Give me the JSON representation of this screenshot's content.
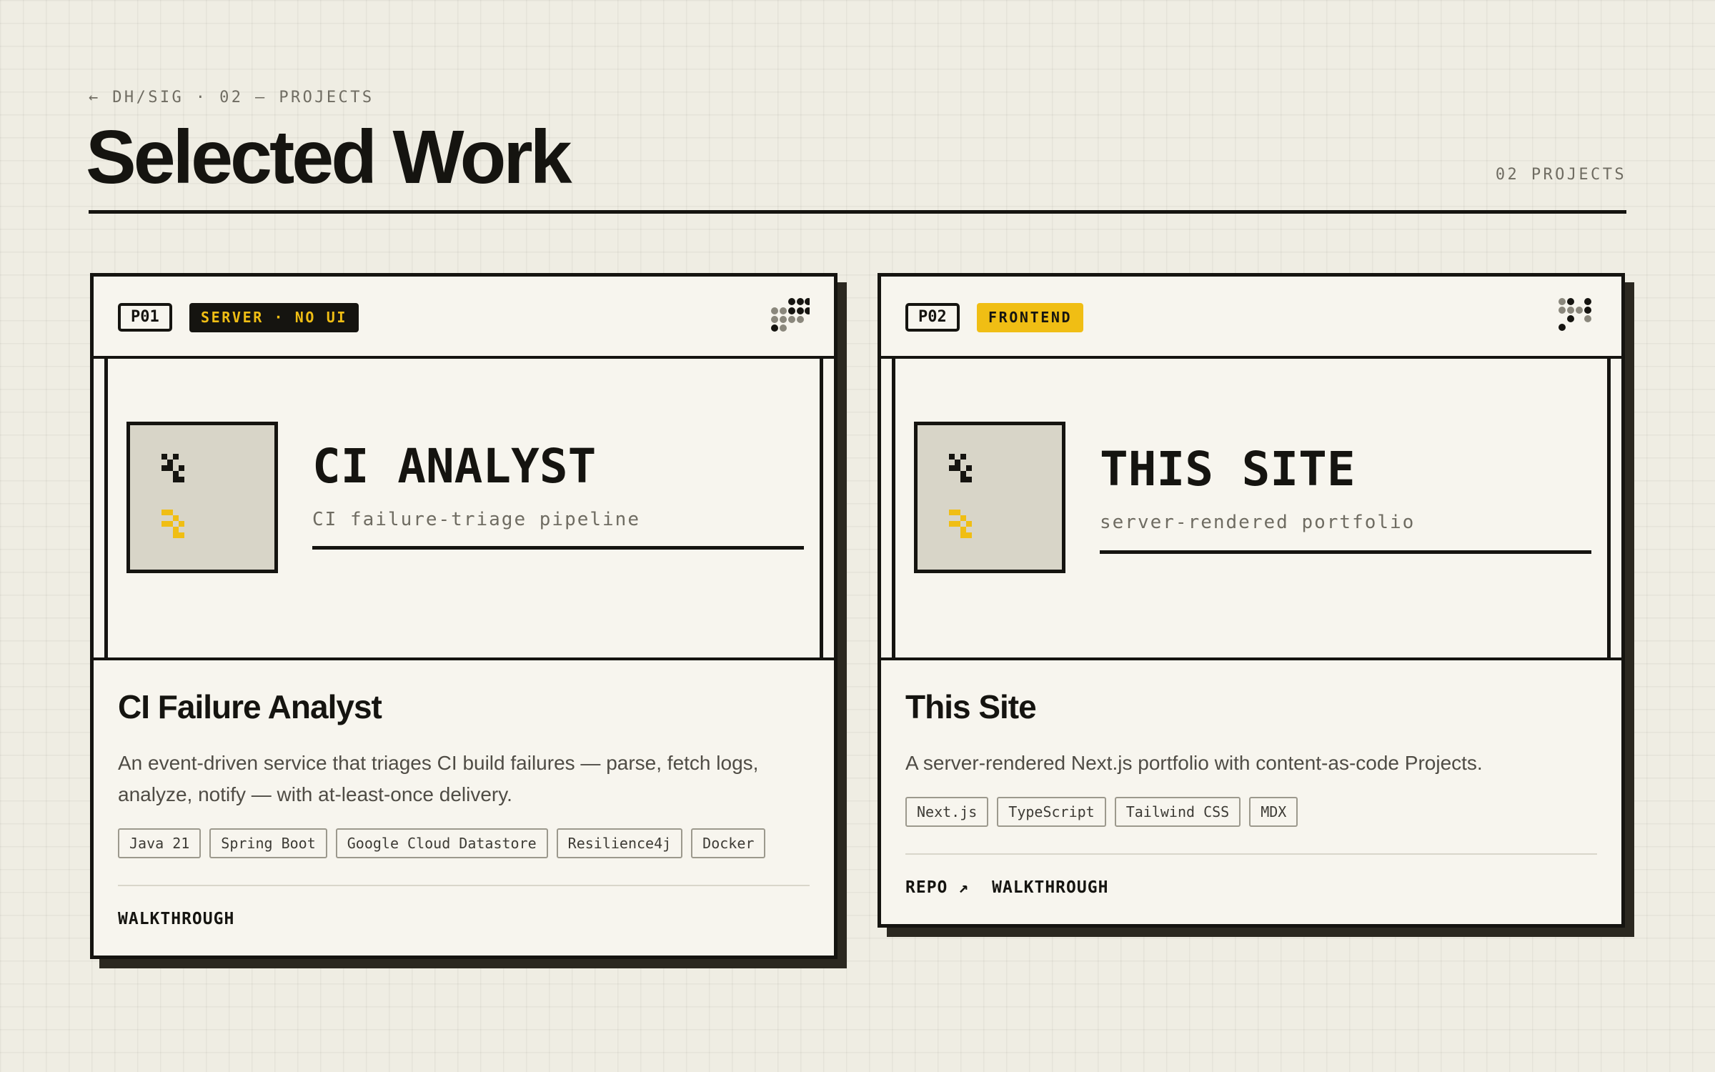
{
  "header": {
    "breadcrumb": "← DH/SIG · 02 — PROJECTS",
    "title": "Selected Work",
    "count": "02 PROJECTS"
  },
  "projects": [
    {
      "id": "P01",
      "category": "SERVER · NO UI",
      "hero_title": "CI ANALYST",
      "hero_subtitle": "CI failure-triage pipeline",
      "title": "CI Failure Analyst",
      "description": "An event-driven service that triages CI build failures — parse, fetch logs, analyze, notify — with at-least-once delivery.",
      "tags": [
        "Java 21",
        "Spring Boot",
        "Google Cloud Datastore",
        "Resilience4j",
        "Docker"
      ],
      "links": [
        "WALKTHROUGH"
      ]
    },
    {
      "id": "P02",
      "category": "FRONTEND",
      "hero_title": "THIS SITE",
      "hero_subtitle": "server-rendered portfolio",
      "title": "This Site",
      "description": "A server-rendered Next.js portfolio with content-as-code Projects.",
      "tags": [
        "Next.js",
        "TypeScript",
        "Tailwind CSS",
        "MDX"
      ],
      "links": [
        "REPO ↗",
        "WALKTHROUGH"
      ]
    }
  ],
  "colors": {
    "background": "#efede3",
    "ink": "#151410",
    "card": "#f7f5ee",
    "accent_yellow": "#f0be14",
    "hero_tile": "#d8d5c8"
  },
  "icons": [
    "arrow-left-icon",
    "dot-matrix-icon",
    "pixel-glyph-icon",
    "arrow-up-right-icon"
  ]
}
